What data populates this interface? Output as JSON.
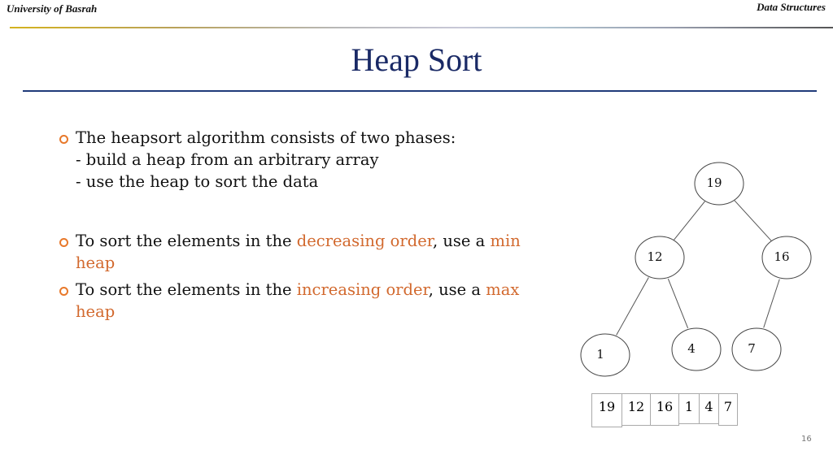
{
  "header": {
    "left": "University of Basrah",
    "right": "Data Structures"
  },
  "title": "Heap Sort",
  "bullets": [
    {
      "line1": "The heapsort algorithm consists of two phases:",
      "line2": "- build a heap from an arbitrary array",
      "line3": "- use the heap to sort the data"
    },
    {
      "t1": "To sort the elements in the ",
      "hl1": "decreasing order",
      "t2": ", use a ",
      "hl2": "min heap"
    },
    {
      "t1": "To sort the elements in the ",
      "hl1": "increasing order",
      "t2": ", use a ",
      "hl2": "max heap"
    }
  ],
  "heap": {
    "nodes": [
      "19",
      "12",
      "16",
      "1",
      "4",
      "7"
    ],
    "edges": [
      [
        0,
        1
      ],
      [
        0,
        2
      ],
      [
        1,
        3
      ],
      [
        1,
        4
      ],
      [
        2,
        5
      ]
    ]
  },
  "array": [
    "19",
    "12",
    "16",
    "1",
    "4",
    "7"
  ],
  "page_number": "16",
  "colors": {
    "title": "#1a2a66",
    "highlight": "#d2692e",
    "bullet": "#e8782a"
  }
}
